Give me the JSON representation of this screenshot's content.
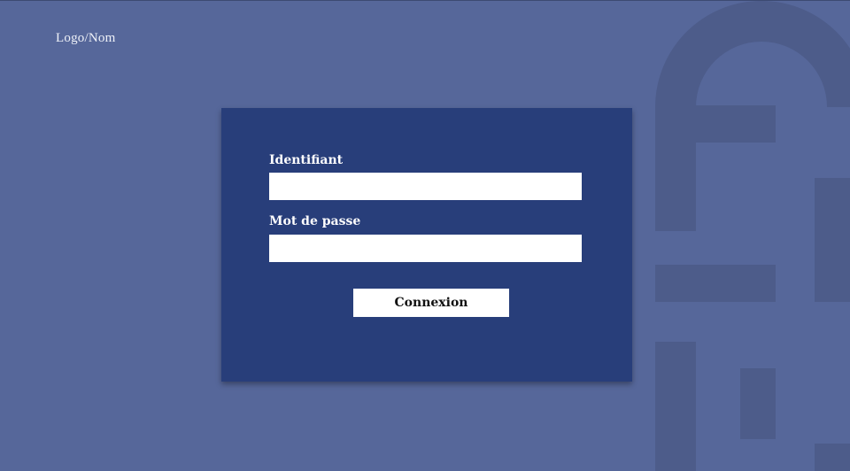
{
  "header": {
    "logo_text": "Logo/Nom"
  },
  "login_form": {
    "username_label": "Identifiant",
    "username_value": "",
    "password_label": "Mot de passe",
    "password_value": "",
    "submit_label": "Connexion"
  },
  "background": {
    "icon": "lock-icon",
    "color": "#56679a"
  },
  "colors": {
    "card": "#283e7a",
    "input": "#ffffff",
    "button": "#ffffff"
  }
}
